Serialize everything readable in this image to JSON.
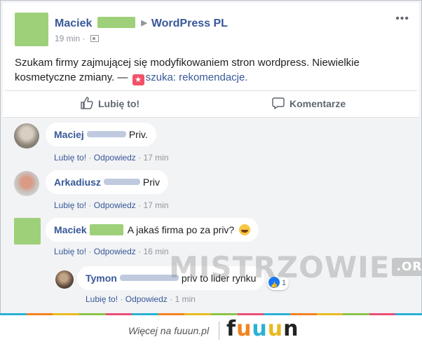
{
  "post": {
    "author": "Maciek",
    "group": "WordPress PL",
    "time": "19 min",
    "more": "•••",
    "text": "Szukam firmy zajmującej się modyfikowaniem stron wordpress. Niewielkie kosmetyczne zmiany. —",
    "tag_label": "szuka: rekomendacje.",
    "like_label": "Lubię to!",
    "comment_label": "Komentarze"
  },
  "comments": [
    {
      "author": "Maciej",
      "text": "Priv.",
      "like": "Lubię to!",
      "reply": "Odpowiedz",
      "time": "17 min"
    },
    {
      "author": "Arkadiusz",
      "text": "Priv",
      "like": "Lubię to!",
      "reply": "Odpowiedz",
      "time": "17 min"
    },
    {
      "author": "Maciek",
      "text": "A jakaś firma po za priv?",
      "like": "Lubię to!",
      "reply": "Odpowiedz",
      "time": "16 min"
    },
    {
      "author": "Tymon",
      "text": "priv to lider rynku",
      "like": "Lubię to!",
      "reply": "Odpowiedz",
      "time": "1 min",
      "reactions": "1"
    }
  ],
  "separator": "·",
  "watermark": {
    "main": "MISTRZOWIE",
    "suffix": ".ORG"
  },
  "footer": {
    "more_text": "Więcej na fuuun.pl",
    "logo_f": "f",
    "logo_u1": "u",
    "logo_u2": "u",
    "logo_u3": "u",
    "logo_n": "n"
  },
  "colors": {
    "link": "#385898",
    "text": "#1c1e21",
    "muted": "#90949c",
    "like_blue": "#1877f2"
  }
}
